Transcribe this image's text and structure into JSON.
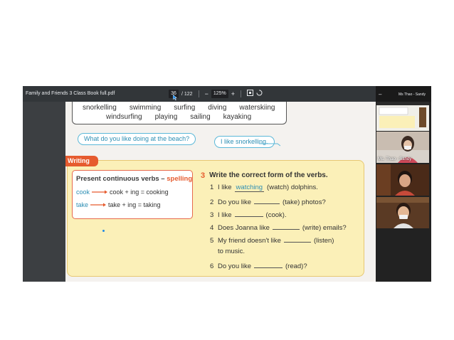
{
  "viewer": {
    "file_title": "Family and Friends 3 Class Book full.pdf",
    "current_page": "36",
    "total_pages": "/ 122",
    "zoom": "125%",
    "zoom_out_icon": "minus-icon",
    "zoom_in_icon": "plus-icon",
    "fit_icon": "fit-page-icon",
    "rotate_icon": "rotate-icon"
  },
  "page": {
    "vocab_row1": [
      "snorkelling",
      "swimming",
      "surfing",
      "diving",
      "waterskiing"
    ],
    "vocab_row2": [
      "windsurfing",
      "playing",
      "sailing",
      "kayaking"
    ],
    "question_bubble": "What do you like doing at the beach?",
    "answer_bubble": "I like snorkelling.",
    "writing_tag": "Writing",
    "grammar": {
      "title_main": "Present continuous verbs – ",
      "title_accent": "spelling",
      "line1_verb": "cook",
      "line1_rule": "cook + ing = cooking",
      "line2_verb": "take",
      "line2_rule": "take + ing = taking"
    },
    "exercise": {
      "number": "3",
      "heading": "Write the correct form of the verbs.",
      "items": [
        {
          "n": "1",
          "before": "I like",
          "fill": "watching",
          "after": "(watch) dolphins."
        },
        {
          "n": "2",
          "before": "Do you like",
          "fill": "",
          "after": "(take) photos?"
        },
        {
          "n": "3",
          "before": "I like",
          "fill": "",
          "after": "(cook)."
        },
        {
          "n": "4",
          "before": "Does Joanna like",
          "fill": "",
          "after": "(write) emails?"
        },
        {
          "n": "5",
          "before": "My friend doesn't like",
          "fill": "",
          "after": "(listen)"
        },
        {
          "n": "",
          "before": "to music.",
          "fill": "",
          "after": ""
        },
        {
          "n": "6",
          "before": "Do you like",
          "fill": "",
          "after": "(read)?"
        }
      ]
    }
  },
  "video_panel": {
    "host_label": "Ms Thao - Sandy",
    "tile2_label": "Ms. Thao - Sandy"
  },
  "colors": {
    "accent_orange": "#e65b2e",
    "accent_blue": "#2e8fb4",
    "panel_yellow": "#fbf0b8",
    "toolbar_dark": "#323639"
  }
}
